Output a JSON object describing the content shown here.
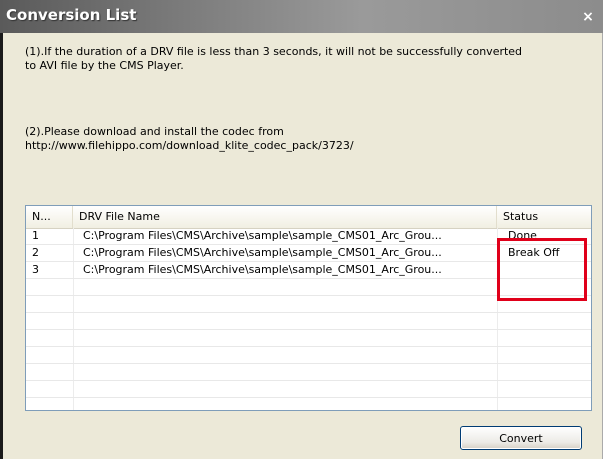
{
  "window": {
    "title": "Conversion List",
    "close_glyph": "×"
  },
  "notes": {
    "note1": "(1).If the duration of a DRV file is less than 3 seconds, it will not be successfully converted\nto AVI file by the CMS Player.",
    "note2": "(2).Please download and install the codec from\nhttp://www.filehippo.com/download_klite_codec_pack/3723/"
  },
  "list": {
    "headers": {
      "no": "N...",
      "name": "DRV File Name",
      "status": "Status"
    },
    "rows": [
      {
        "no": "1",
        "name": "C:\\Program Files\\CMS\\Archive\\sample\\sample_CMS01_Arc_Grou...",
        "status": "Done"
      },
      {
        "no": "2",
        "name": "C:\\Program Files\\CMS\\Archive\\sample\\sample_CMS01_Arc_Grou...",
        "status": "Break Off"
      },
      {
        "no": "3",
        "name": "C:\\Program Files\\CMS\\Archive\\sample\\sample_CMS01_Arc_Grou...",
        "status": ""
      },
      {
        "no": "",
        "name": "",
        "status": ""
      },
      {
        "no": "",
        "name": "",
        "status": ""
      },
      {
        "no": "",
        "name": "",
        "status": ""
      },
      {
        "no": "",
        "name": "",
        "status": ""
      },
      {
        "no": "",
        "name": "",
        "status": ""
      },
      {
        "no": "",
        "name": "",
        "status": ""
      },
      {
        "no": "",
        "name": "",
        "status": ""
      }
    ]
  },
  "actions": {
    "convert_label": "Convert"
  },
  "colors": {
    "highlight": "#e0001a",
    "title_bar": "#7b7b7b",
    "dialog_bg": "#ece9d8"
  }
}
